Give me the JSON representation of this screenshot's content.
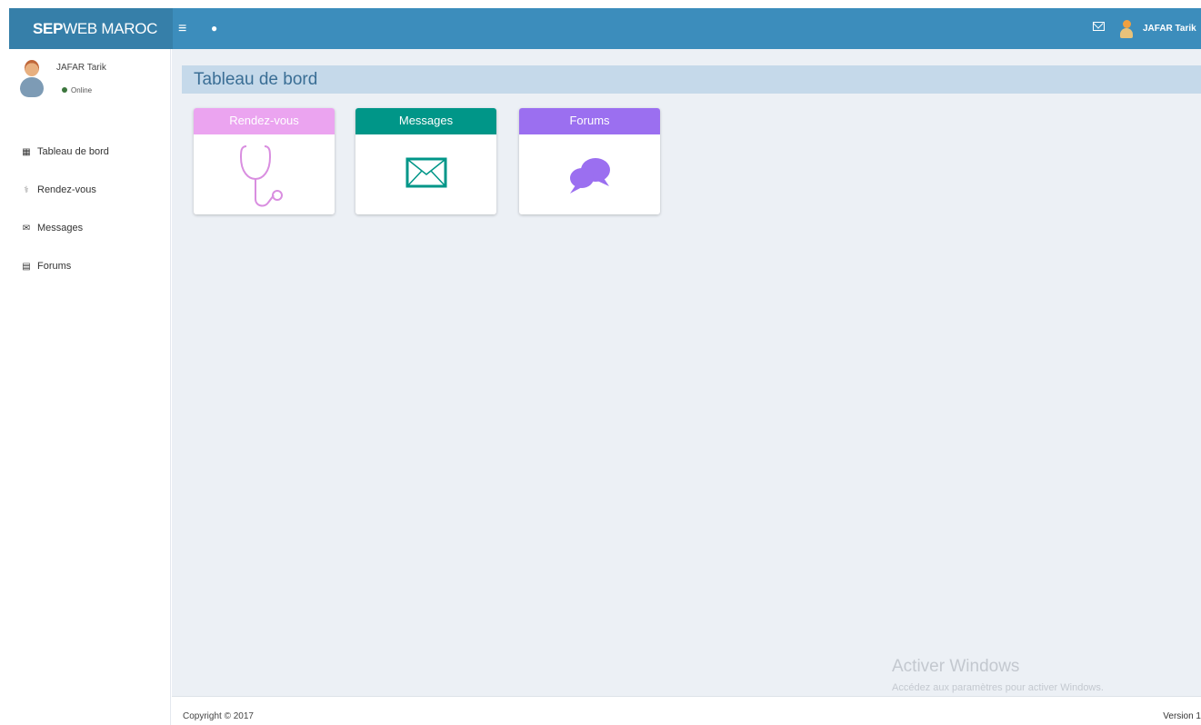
{
  "header": {
    "brand_bold": "SEP",
    "brand_rest": "WEB MAROC",
    "toggle_icon": "bars-icon",
    "dot_icon": "circle-icon",
    "mail_icon": "envelope-icon",
    "user_name": "JAFAR Tarik",
    "color": "#3c8dbc"
  },
  "sidebar": {
    "user_name": "JAFAR Tarik",
    "status": "Online",
    "items": [
      {
        "label": "Tableau de bord",
        "icon": "dashboard-icon"
      },
      {
        "label": "Rendez-vous",
        "icon": "stethoscope-icon"
      },
      {
        "label": "Messages",
        "icon": "envelope-icon"
      },
      {
        "label": "Forums",
        "icon": "comments-icon"
      }
    ]
  },
  "main": {
    "title": "Tableau de bord",
    "cards": [
      {
        "label": "Rendez-vous",
        "color": "#eba4f0",
        "icon": "stethoscope-icon"
      },
      {
        "label": "Messages",
        "color": "#009688",
        "icon": "envelope-icon"
      },
      {
        "label": "Forums",
        "color": "#9b6ff0",
        "icon": "comments-icon"
      }
    ]
  },
  "watermark": {
    "title": "Activer Windows",
    "subtitle": "Accédez aux paramètres pour activer Windows."
  },
  "footer": {
    "copyright": "Copyright © 2017",
    "version": "Version 1"
  }
}
